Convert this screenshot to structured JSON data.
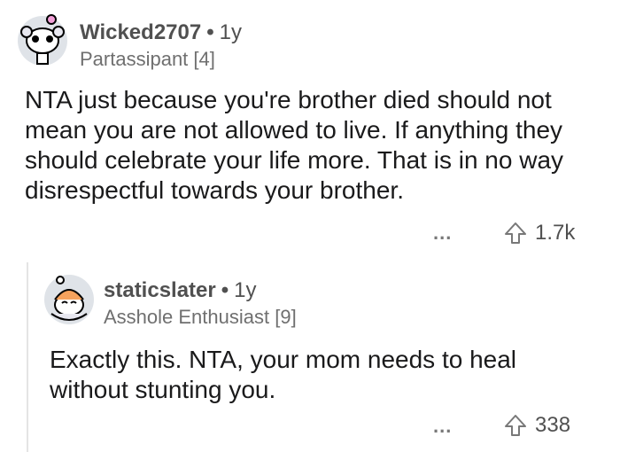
{
  "comment": {
    "username": "Wicked2707",
    "separator": "•",
    "age": "1y",
    "flair": "Partassipant [4]",
    "body": "NTA just because you're brother died should not mean you are not allowed to live. If anything they should celebrate your life more. That is in no way disrespectful towards your brother.",
    "more_label": "...",
    "upvote_icon": "upvote-arrow-icon",
    "score": "1.7k"
  },
  "reply": {
    "username": "staticslater",
    "separator": "•",
    "age": "1y",
    "flair": "Asshole Enthusiast [9]",
    "body": "Exactly this. NTA, your mom needs to heal without stunting you.",
    "more_label": "...",
    "upvote_icon": "upvote-arrow-icon",
    "score": "338"
  }
}
